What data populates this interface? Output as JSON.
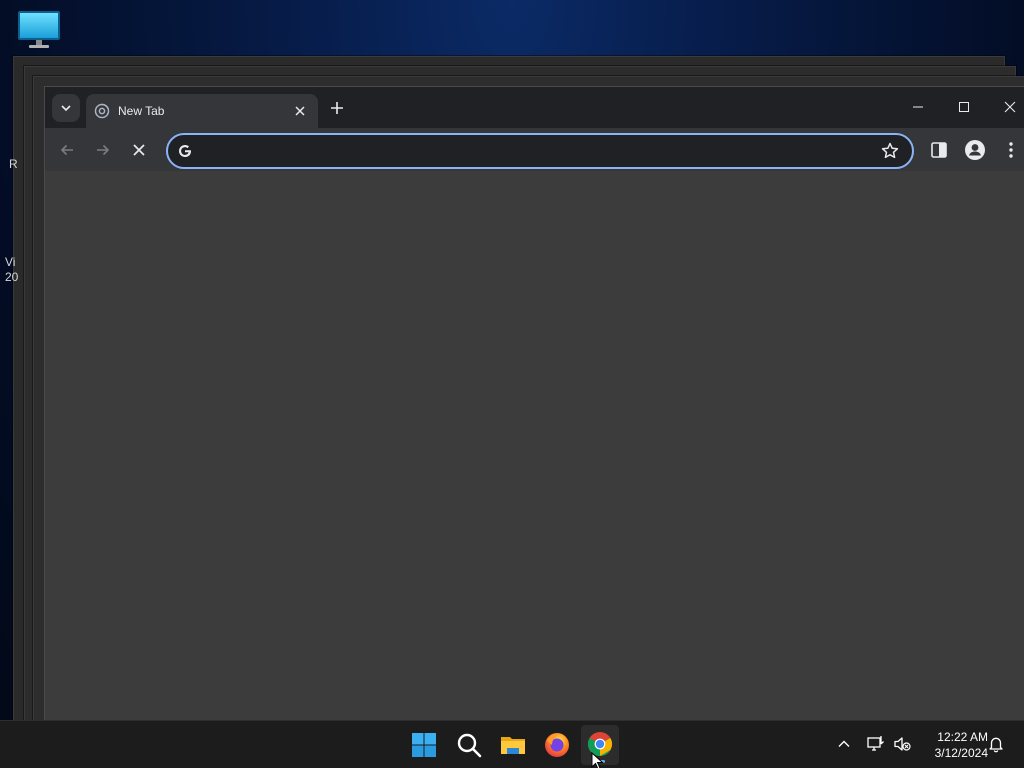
{
  "desktop": {
    "side_labels": [
      "R",
      "Vi",
      "20"
    ]
  },
  "browser": {
    "tab": {
      "title": "New Tab"
    },
    "omnibox": {
      "value": "",
      "placeholder": ""
    },
    "colors": {
      "accent": "#8ab4f8",
      "titlebar": "#202124",
      "toolbar": "#35363a",
      "content": "#3c3c3c"
    }
  },
  "taskbar": {
    "apps": [
      "start-icon",
      "search-icon",
      "file-explorer-icon",
      "firefox-icon",
      "chrome-icon"
    ],
    "clock": {
      "time": "12:22 AM",
      "date": "3/12/2024"
    }
  }
}
